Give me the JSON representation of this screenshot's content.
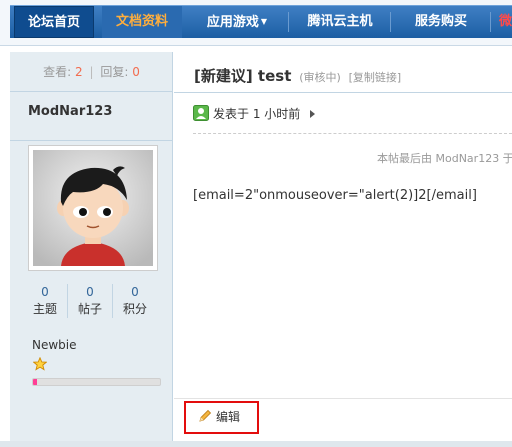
{
  "nav": {
    "items": [
      {
        "label": "论坛首页"
      },
      {
        "label": "文档资料"
      },
      {
        "label": "应用游戏"
      },
      {
        "label": "腾讯云主机"
      },
      {
        "label": "服务购买"
      },
      {
        "label": "微社"
      }
    ],
    "accent": "#ffae3d",
    "bar_color": "#1c5ea3"
  },
  "stats": {
    "views_label": "查看:",
    "views": "2",
    "replies_label": "回复:",
    "replies": "0"
  },
  "author": {
    "name": "ModNar123",
    "counts": [
      {
        "value": "0",
        "label": "主题"
      },
      {
        "value": "0",
        "label": "帖子"
      },
      {
        "value": "0",
        "label": "积分"
      }
    ],
    "rank": "Newbie",
    "rank_icon": "star-icon",
    "rank_progress_percent": 3
  },
  "post": {
    "title": "[新建议] test",
    "status": "(审核中)",
    "copy_link": "[复制链接]",
    "posted_prefix": "发表于",
    "posted_time": "1 小时前",
    "last_edit": "本帖最后由 ModNar123 于",
    "content": "[email=2\"onmouseover=\"alert(2)]2[/email]"
  },
  "actions": {
    "edit_label": "编辑",
    "highlight_color": "#e30d0d"
  }
}
